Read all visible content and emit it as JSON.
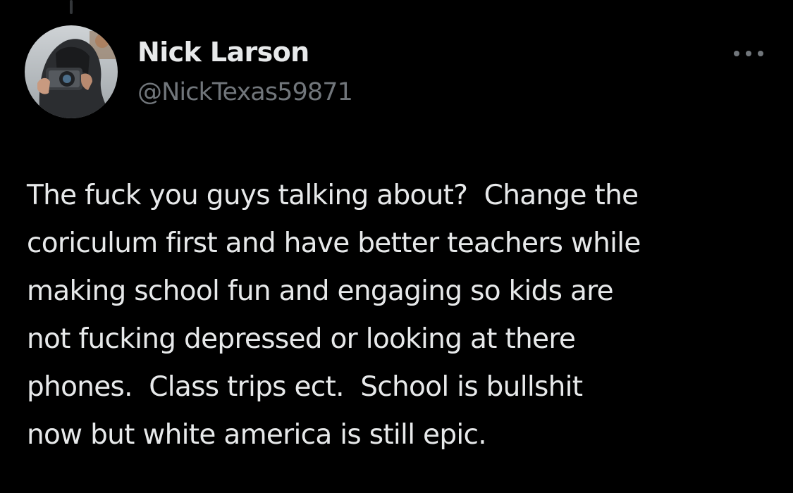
{
  "tweet": {
    "author": {
      "display_name": "Nick Larson",
      "handle": "@NickTexas59871"
    },
    "more_menu_icon": "more-horizontal-icon",
    "text_lines": [
      "The fuck you guys talking about?  Change the",
      "coriculum first and have better teachers while",
      "making school fun and engaging so kids are",
      "not fucking depressed or looking at there",
      "phones.  Class trips ect.  School is bullshit",
      "now but white america is still epic."
    ]
  },
  "colors": {
    "background": "#000000",
    "primary_text": "#e7e9ea",
    "secondary_text": "#71767b"
  }
}
